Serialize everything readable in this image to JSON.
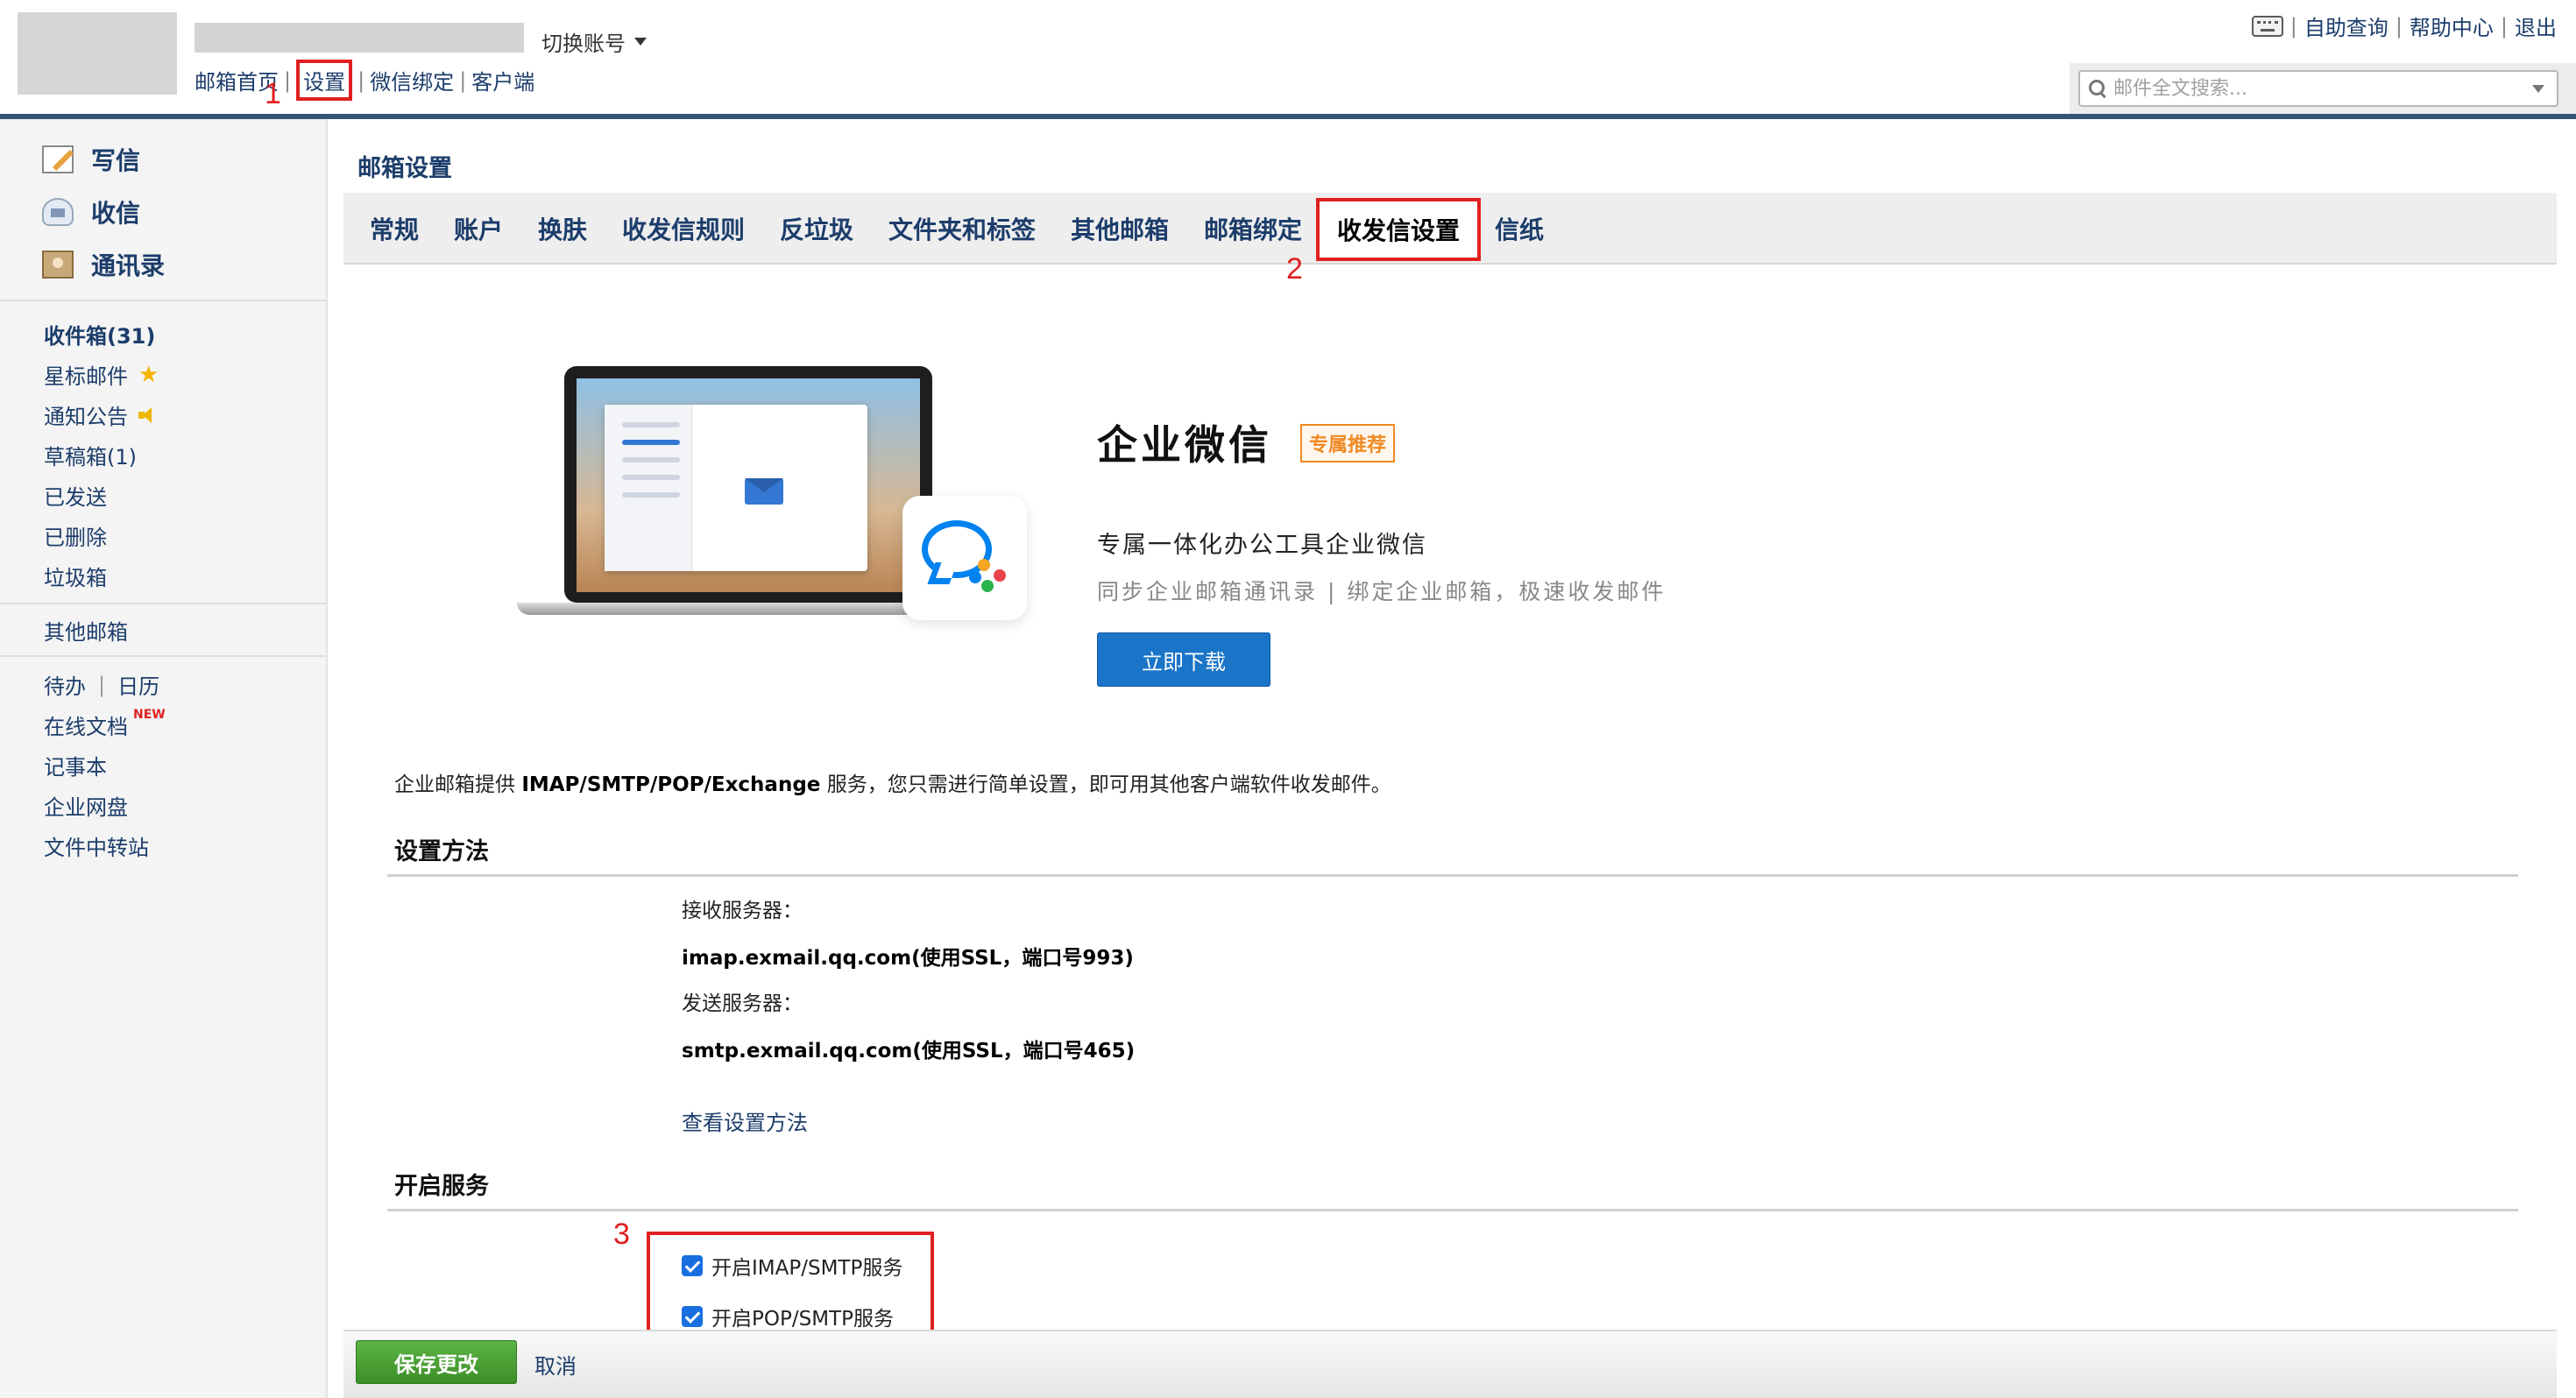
{
  "header": {
    "switch_account": "切换账号",
    "nav": [
      "邮箱首页",
      "设置",
      "微信绑定",
      "客户端"
    ],
    "right_links": [
      "自助查询",
      "帮助中心",
      "退出"
    ],
    "search_placeholder": "邮件全文搜索..."
  },
  "annotations": [
    "1",
    "2",
    "3"
  ],
  "sidebar": {
    "main": [
      "写信",
      "收信",
      "通讯录"
    ],
    "folders": [
      "收件箱(31)",
      "星标邮件",
      "通知公告",
      "草稿箱(1)",
      "已发送",
      "已删除",
      "垃圾箱"
    ],
    "other_mail": "其他邮箱",
    "todo": "待办",
    "calendar": "日历",
    "tools": [
      "在线文档",
      "记事本",
      "企业网盘",
      "文件中转站"
    ],
    "new_badge": "NEW"
  },
  "page_title": "邮箱设置",
  "tabs": [
    "常规",
    "账户",
    "换肤",
    "收发信规则",
    "反垃圾",
    "文件夹和标签",
    "其他邮箱",
    "邮箱绑定",
    "收发信设置",
    "信纸"
  ],
  "active_tab": "收发信设置",
  "banner": {
    "title": "企业微信",
    "badge": "专属推荐",
    "subtitle": "专属一体化办公工具企业微信",
    "desc": "同步企业邮箱通讯录 | 绑定企业邮箱，极速收发邮件",
    "download": "立即下载"
  },
  "intro": {
    "prefix": "企业邮箱提供 ",
    "protocols": "IMAP/SMTP/POP/Exchange",
    "suffix": " 服务，您只需进行简单设置，即可用其他客户端软件收发邮件。"
  },
  "setup": {
    "title": "设置方法",
    "recv_label": "接收服务器：",
    "recv_value": "imap.exmail.qq.com(使用SSL，端口号993)",
    "send_label": "发送服务器：",
    "send_value": "smtp.exmail.qq.com(使用SSL，端口号465)",
    "help_link": "查看设置方法"
  },
  "service": {
    "title": "开启服务",
    "imap": "开启IMAP/SMTP服务",
    "pop": "开启POP/SMTP服务"
  },
  "footer": {
    "save": "保存更改",
    "cancel": "取消"
  },
  "colors": {
    "brand_blue": "#1c3d6b",
    "header_bar": "#355479",
    "highlight_red": "#e02020",
    "save_green": "#3d8f28",
    "download_blue": "#1a74c8",
    "badge_orange": "#f08a24"
  }
}
